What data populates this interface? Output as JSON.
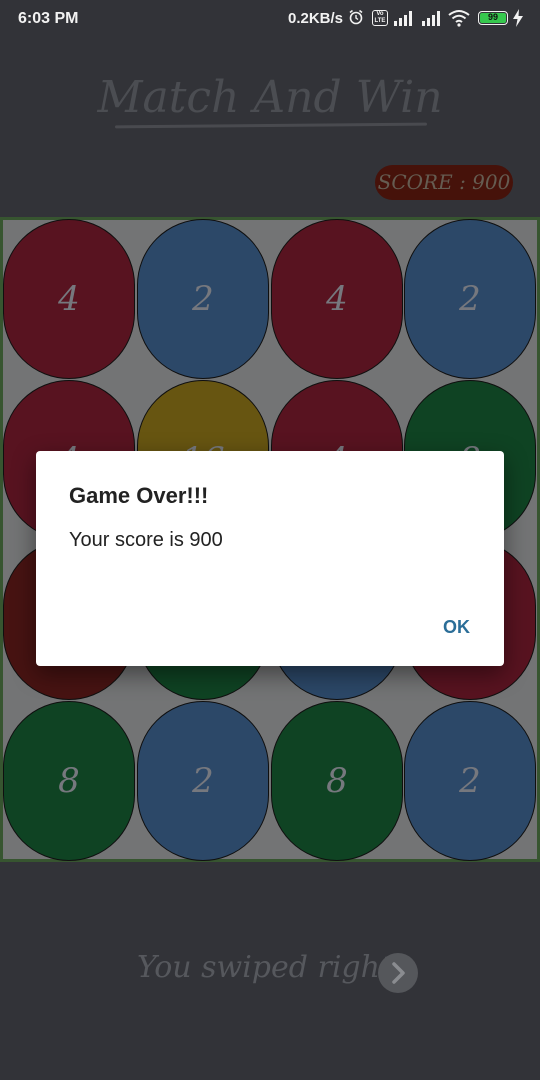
{
  "status_bar": {
    "time": "6:03 PM",
    "network_speed": "0.2KB/s",
    "volte_label": "Vo LTE",
    "battery_level": "99",
    "battery_color": "#39d353"
  },
  "header": {
    "title": "Match And Win",
    "score_label": "SCORE : 900"
  },
  "board": {
    "border_color": "#3a5a33",
    "tiles": [
      {
        "value": "4",
        "color": "red"
      },
      {
        "value": "2",
        "color": "blue"
      },
      {
        "value": "4",
        "color": "red"
      },
      {
        "value": "2",
        "color": "blue"
      },
      {
        "value": "4",
        "color": "red"
      },
      {
        "value": "16",
        "color": "gold"
      },
      {
        "value": "4",
        "color": "red"
      },
      {
        "value": "8",
        "color": "green"
      },
      {
        "value": "",
        "color": "darkred"
      },
      {
        "value": "",
        "color": "green"
      },
      {
        "value": "",
        "color": "blue"
      },
      {
        "value": "",
        "color": "red"
      },
      {
        "value": "8",
        "color": "green"
      },
      {
        "value": "2",
        "color": "blue"
      },
      {
        "value": "8",
        "color": "green"
      },
      {
        "value": "2",
        "color": "blue"
      }
    ]
  },
  "dialog": {
    "title": "Game Over!!!",
    "message": "Your score is 900",
    "ok_label": "OK",
    "ok_color": "#2b6e98"
  },
  "footer": {
    "swipe_text": "You swiped right!",
    "arrow_icon": "chevron-right-icon"
  }
}
